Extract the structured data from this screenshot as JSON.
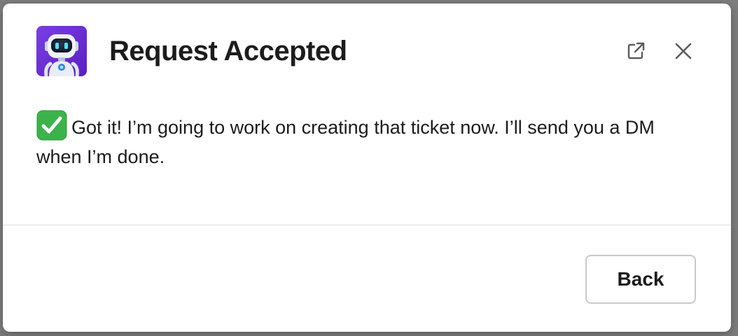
{
  "modal": {
    "title": "Request Accepted",
    "app_icon": "robot-icon",
    "header_actions": [
      {
        "icon": "external-link-icon"
      },
      {
        "icon": "close-icon"
      }
    ]
  },
  "message": {
    "emoji": "white-check-mark-emoji",
    "text": "Got it! I’m going to work on creating that ticket now. I’ll send you a DM when I’m done."
  },
  "footer": {
    "back_label": "Back"
  },
  "colors": {
    "avatar_bg": "#6b2fd6",
    "check_green": "#3bb34a",
    "text": "#1d1c1d"
  }
}
